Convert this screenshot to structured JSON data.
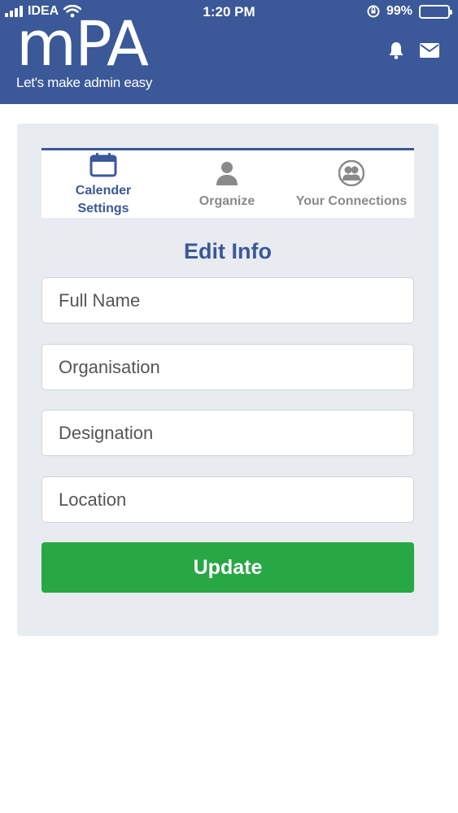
{
  "status_bar": {
    "carrier": "IDEA",
    "time": "1:20 PM",
    "battery": "99%",
    "icons": [
      "signal-icon",
      "wifi-icon",
      "rotation-lock-icon",
      "battery-icon"
    ]
  },
  "header": {
    "brand": "mPA",
    "tagline": "Let's make admin easy",
    "icons": [
      "bell-icon",
      "mail-icon"
    ],
    "background": "#3b5898"
  },
  "tabs": [
    {
      "label_line1": "Calender",
      "label_line2": "Settings",
      "icon": "calendar-icon",
      "active": true
    },
    {
      "label": "Organize",
      "icon": "person-icon",
      "active": false
    },
    {
      "label": "Your Connections",
      "icon": "connections-icon",
      "active": false
    }
  ],
  "form": {
    "title": "Edit Info",
    "fields": [
      {
        "placeholder": "Full Name",
        "value": ""
      },
      {
        "placeholder": "Organisation",
        "value": ""
      },
      {
        "placeholder": "Designation",
        "value": ""
      },
      {
        "placeholder": "Location",
        "value": ""
      }
    ],
    "submit_label": "Update"
  },
  "colors": {
    "primary": "#3b5898",
    "success": "#28a745",
    "card_bg": "#e8ebf0"
  }
}
